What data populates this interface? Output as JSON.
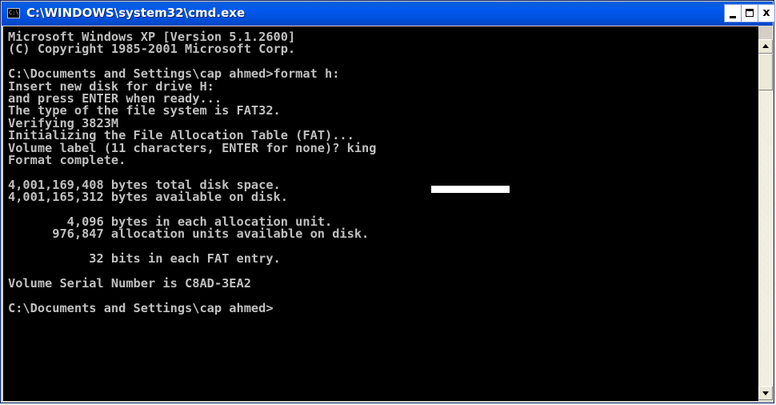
{
  "window": {
    "title": "C:\\WINDOWS\\system32\\cmd.exe",
    "icon": "cmd-icon",
    "icon_text": "C:\\",
    "controls": [
      "minimize-icon",
      "maximize-icon",
      "close-icon"
    ],
    "close_glyph": "x"
  },
  "console": {
    "background": "#000000",
    "text_color": "#c0c0c0",
    "redaction_color": "#ffffff",
    "lines": [
      "Microsoft Windows XP [Version 5.1.2600]",
      "(C) Copyright 1985-2001 Microsoft Corp.",
      "",
      "C:\\Documents and Settings\\cap ahmed>format h:",
      "Insert new disk for drive H:",
      "and press ENTER when ready...",
      "The type of the file system is FAT32.",
      "Verifying 3823M",
      "Initializing the File Allocation Table (FAT)...",
      "Volume label (11 characters, ENTER for none)? king",
      "Format complete.",
      "",
      "4,001,169,408 bytes total disk space.",
      "4,001,165,312 bytes available on disk.",
      "",
      "        4,096 bytes in each allocation unit.",
      "      976,847 allocation units available on disk.",
      "",
      "           32 bits in each FAT entry.",
      "",
      "Volume Serial Number is C8AD-3EA2",
      "",
      "C:\\Documents and Settings\\cap ahmed>"
    ]
  },
  "scrollbar": {
    "up_icon": "arrow-up-icon",
    "down_icon": "arrow-down-icon"
  }
}
